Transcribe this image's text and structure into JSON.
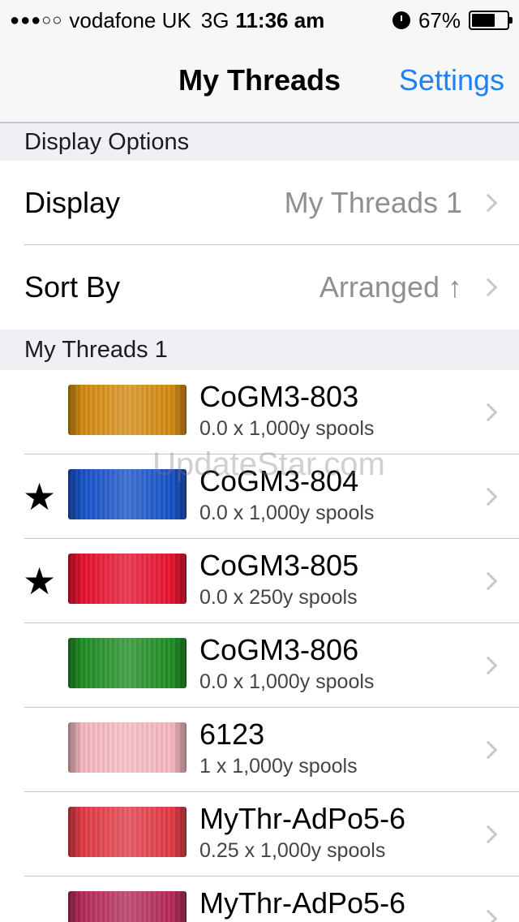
{
  "status_bar": {
    "signal": "●●●○○",
    "carrier": "vodafone UK",
    "network": "3G",
    "time": "11:36 am",
    "battery_percent": "67%",
    "battery_level": 0.67
  },
  "nav": {
    "title": "My Threads",
    "settings_label": "Settings"
  },
  "display_options": {
    "header": "Display Options",
    "display_label": "Display",
    "display_value": "My Threads 1",
    "sort_label": "Sort By",
    "sort_value": "Arranged ↑"
  },
  "list": {
    "header": "My Threads 1",
    "items": [
      {
        "name": "CoGM3-803",
        "qty": "0.0 x 1,000y spools",
        "starred": false,
        "color": "#d48a10"
      },
      {
        "name": "CoGM3-804",
        "qty": "0.0 x 1,000y spools",
        "starred": true,
        "color": "#1552c8"
      },
      {
        "name": "CoGM3-805",
        "qty": "0.0 x 250y spools",
        "starred": true,
        "color": "#e8102e"
      },
      {
        "name": "CoGM3-806",
        "qty": "0.0 x 1,000y spools",
        "starred": false,
        "color": "#1e8e22"
      },
      {
        "name": "6123",
        "qty": "1 x 1,000y spools",
        "starred": false,
        "color": "#f6b8c0"
      },
      {
        "name": "MyThr-AdPo5-6",
        "qty": "0.25 x 1,000y spools",
        "starred": false,
        "color": "#e23a44"
      },
      {
        "name": "MyThr-AdPo5-6",
        "qty": "",
        "starred": false,
        "color": "#b42a5a"
      }
    ],
    "star_glyph": "★"
  },
  "watermark": "UpdateStar.com"
}
